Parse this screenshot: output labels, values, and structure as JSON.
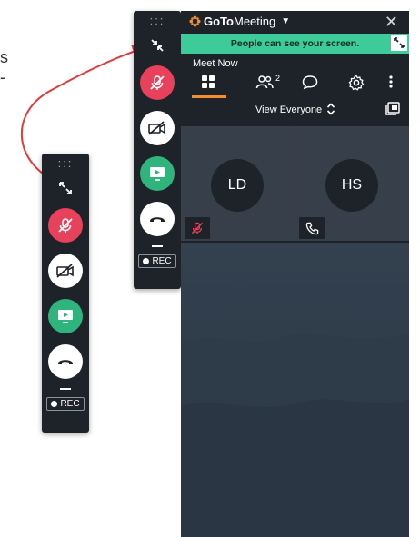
{
  "edge_text": [
    "s",
    "-"
  ],
  "compact_bar": {
    "drag_handle": ":::",
    "rec_label": "REC"
  },
  "app": {
    "brand_bold": "GoTo",
    "brand_thin": "Meeting",
    "banner_text": "People can see your screen.",
    "meeting_title": "Meet Now",
    "participants_count": "2",
    "view_label": "View Everyone"
  },
  "participants": [
    {
      "initials": "LD",
      "status": "muted-mic-icon"
    },
    {
      "initials": "HS",
      "status": "phone-icon"
    }
  ],
  "colors": {
    "accent": "#f68d2e",
    "banner": "#3ecb9a",
    "mute_red": "#e8415c",
    "share_green": "#2fb47d",
    "panel_bg": "#1e232a",
    "arrow_red": "#e23a3a"
  }
}
